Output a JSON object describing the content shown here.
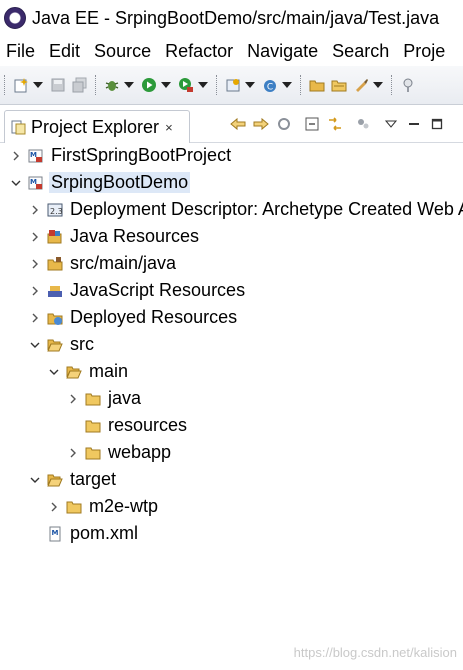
{
  "window": {
    "title": "Java EE - SrpingBootDemo/src/main/java/Test.java"
  },
  "menu": [
    "File",
    "Edit",
    "Source",
    "Refactor",
    "Navigate",
    "Search",
    "Proje"
  ],
  "view": {
    "tab_label": "Project Explorer",
    "close_label": "×"
  },
  "tree": [
    {
      "label": "FirstSpringBootProject",
      "depth": 0,
      "state": "collapsed",
      "icon": "maven-project-icon"
    },
    {
      "label": "SrpingBootDemo",
      "depth": 0,
      "state": "expanded",
      "icon": "maven-project-icon",
      "selected": true
    },
    {
      "label": "Deployment Descriptor: Archetype Created Web Application",
      "depth": 1,
      "state": "collapsed",
      "icon": "deployment-descriptor-icon"
    },
    {
      "label": "Java Resources",
      "depth": 1,
      "state": "collapsed",
      "icon": "java-resources-icon"
    },
    {
      "label": "src/main/java",
      "depth": 1,
      "state": "collapsed",
      "icon": "source-folder-icon"
    },
    {
      "label": "JavaScript Resources",
      "depth": 1,
      "state": "collapsed",
      "icon": "javascript-resources-icon"
    },
    {
      "label": "Deployed Resources",
      "depth": 1,
      "state": "collapsed",
      "icon": "deployed-resources-icon"
    },
    {
      "label": "src",
      "depth": 1,
      "state": "expanded",
      "icon": "folder-open-icon"
    },
    {
      "label": "main",
      "depth": 2,
      "state": "expanded",
      "icon": "folder-open-icon"
    },
    {
      "label": "java",
      "depth": 3,
      "state": "collapsed",
      "icon": "folder-icon"
    },
    {
      "label": "resources",
      "depth": 3,
      "state": "none",
      "icon": "folder-icon"
    },
    {
      "label": "webapp",
      "depth": 3,
      "state": "collapsed",
      "icon": "folder-icon"
    },
    {
      "label": "target",
      "depth": 1,
      "state": "expanded",
      "icon": "folder-open-icon"
    },
    {
      "label": "m2e-wtp",
      "depth": 2,
      "state": "collapsed",
      "icon": "folder-icon"
    },
    {
      "label": "pom.xml",
      "depth": 1,
      "state": "none",
      "icon": "maven-pom-icon"
    }
  ],
  "watermark": "https://blog.csdn.net/kalision"
}
